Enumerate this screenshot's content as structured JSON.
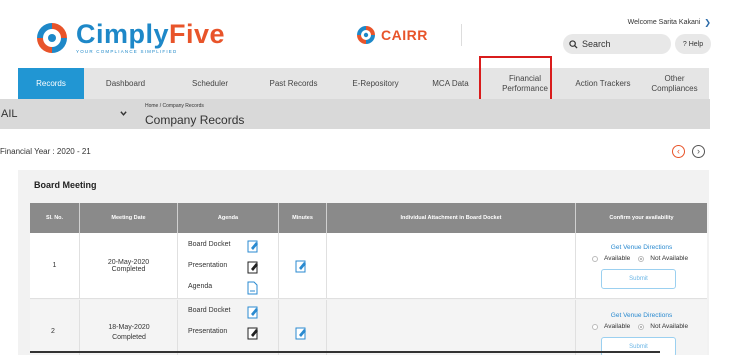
{
  "brand": {
    "name_part1": "Cimply",
    "name_part2": "Five",
    "tagline": "YOUR COMPLIANCE SIMPLIFIED",
    "logo_icon": "cimplyfive-logo-icon",
    "colors": {
      "blue": "#1e88c8",
      "orange": "#e8542a"
    }
  },
  "partner": {
    "name": "CAIRR",
    "logo_icon": "cairr-logo-icon"
  },
  "user": {
    "welcome": "Welcome Sarita  Kakani"
  },
  "search": {
    "label": "Search",
    "icon": "search-icon"
  },
  "help": {
    "label": "? Help"
  },
  "nav": {
    "items": [
      {
        "label": "Records",
        "active": true
      },
      {
        "label": "Dashboard"
      },
      {
        "label": "Scheduler"
      },
      {
        "label": "Past Records"
      },
      {
        "label": "E-Repository"
      },
      {
        "label": "MCA Data"
      },
      {
        "label": "Financial Performance"
      },
      {
        "label": "Action Trackers"
      },
      {
        "label": "Other Compliances"
      }
    ],
    "accent": "#2196d3"
  },
  "company": {
    "selected": "AIL"
  },
  "breadcrumb": "Home  /  Company Records",
  "page_title": "Company Records",
  "financial_year": "Financial Year : 2020 - 21",
  "panel": {
    "title": "Board Meeting",
    "columns": [
      "Sl. No.",
      "Meeting Date",
      "Agenda",
      "Minutes",
      "Individual Attachment in Board Docket",
      "Confirm your availability"
    ],
    "rows": [
      {
        "sl": "1",
        "date": "20-May-2020",
        "status": "Completed",
        "agenda": [
          "Board Docket",
          "Presentation",
          "Agenda"
        ],
        "venue": "Get Venue Directions",
        "available": "Available",
        "not_available": "Not Available",
        "submit": "Submit"
      },
      {
        "sl": "2",
        "date": "18-May-2020",
        "status": "Completed",
        "agenda": [
          "Board Docket",
          "Presentation"
        ],
        "venue": "Get Venue Directions",
        "available": "Available",
        "not_available": "Not Available",
        "submit": "Submit"
      }
    ]
  }
}
